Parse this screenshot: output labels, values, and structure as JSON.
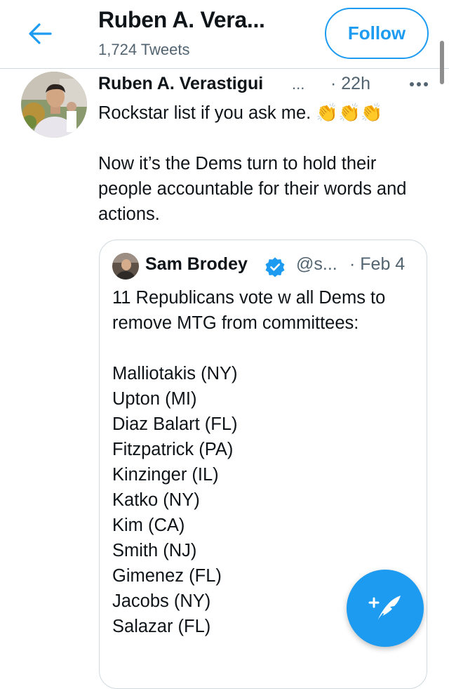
{
  "header": {
    "back_icon": "arrow-left-icon",
    "profile_name": "Ruben A. Vera...",
    "tweet_count": "1,724 Tweets",
    "follow_label": "Follow",
    "accent_color": "#1d9bf0"
  },
  "tweet": {
    "author_name": "Ruben A. Verastigui",
    "author_ellipsis": "...",
    "time": "· 22h",
    "more_icon": "more-horizontal-icon",
    "text": "Rockstar list if you ask me. 👏👏👏\n\nNow it’s the Dems turn to hold their people accountable for their words and actions."
  },
  "quoted_tweet": {
    "author_name": "Sam Brodey",
    "verified_icon": "verified-badge-icon",
    "handle": "@s...",
    "time": "· Feb 4",
    "text": "11 Republicans vote w all Dems to remove MTG from committees:\n\nMalliotakis (NY)\nUpton (MI)\nDiaz Balart (FL)\nFitzpatrick (PA)\nKinzinger (IL)\nKatko (NY)\nKim (CA)\nSmith (NJ)\nGimenez (FL)\nJacobs (NY)\nSalazar (FL)"
  },
  "fab": {
    "icon": "compose-tweet-icon"
  }
}
